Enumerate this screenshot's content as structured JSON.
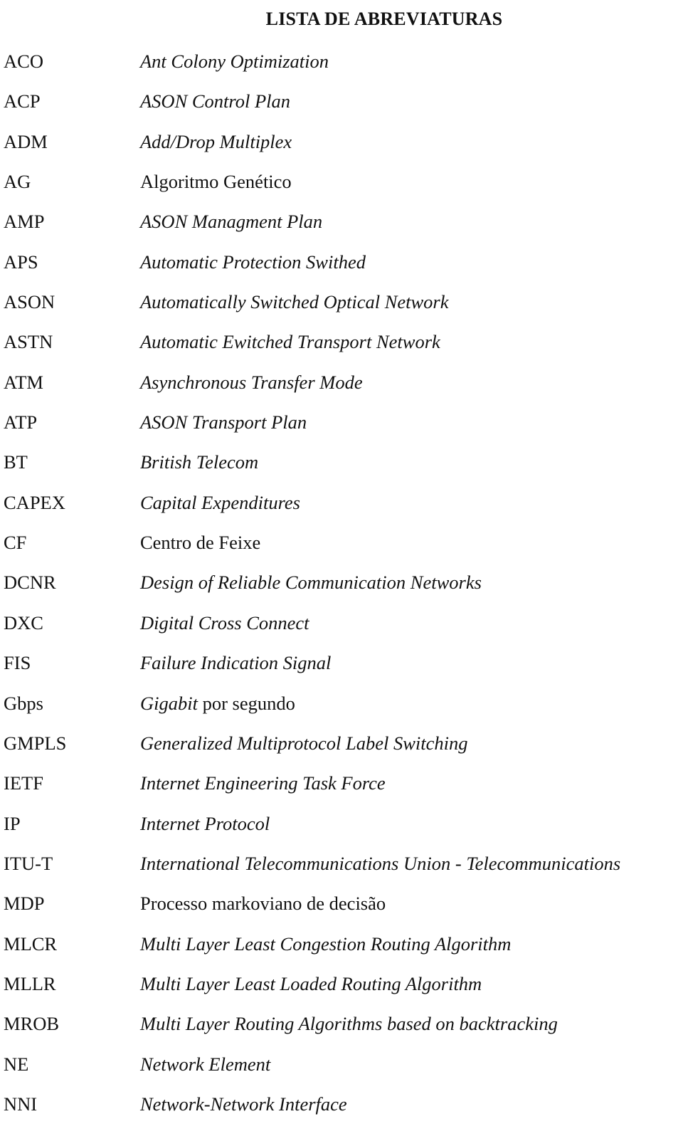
{
  "page": {
    "title": "LISTA DE ABREVIATURAS"
  },
  "abbreviations": [
    {
      "abbr": "ACO",
      "parts": [
        {
          "text": "Ant Colony Optimization",
          "italic": true
        }
      ]
    },
    {
      "abbr": "ACP",
      "parts": [
        {
          "text": "ASON Control Plan",
          "italic": true
        }
      ]
    },
    {
      "abbr": "ADM",
      "parts": [
        {
          "text": "Add/Drop Multiplex",
          "italic": true
        }
      ]
    },
    {
      "abbr": "AG",
      "parts": [
        {
          "text": "Algoritmo Genético",
          "italic": false
        }
      ]
    },
    {
      "abbr": "AMP",
      "parts": [
        {
          "text": "ASON Managment Plan",
          "italic": true
        }
      ]
    },
    {
      "abbr": "APS",
      "parts": [
        {
          "text": "Automatic Protection Swithed",
          "italic": true
        }
      ]
    },
    {
      "abbr": "ASON",
      "parts": [
        {
          "text": "Automatically Switched Optical Network",
          "italic": true
        }
      ]
    },
    {
      "abbr": "ASTN",
      "parts": [
        {
          "text": "Automatic Ewitched Transport Network",
          "italic": true
        }
      ]
    },
    {
      "abbr": "ATM",
      "parts": [
        {
          "text": "Asynchronous Transfer Mode",
          "italic": true
        }
      ]
    },
    {
      "abbr": "ATP",
      "parts": [
        {
          "text": "ASON Transport Plan",
          "italic": true
        }
      ]
    },
    {
      "abbr": "BT",
      "parts": [
        {
          "text": "British Telecom",
          "italic": true
        }
      ]
    },
    {
      "abbr": "CAPEX",
      "parts": [
        {
          "text": "Capital Expenditures",
          "italic": true
        }
      ]
    },
    {
      "abbr": "CF",
      "parts": [
        {
          "text": "Centro de Feixe",
          "italic": false
        }
      ]
    },
    {
      "abbr": "DCNR",
      "parts": [
        {
          "text": "Design of Reliable Communication Networks",
          "italic": true
        }
      ]
    },
    {
      "abbr": "DXC",
      "parts": [
        {
          "text": "Digital Cross Connect",
          "italic": true
        }
      ]
    },
    {
      "abbr": "FIS",
      "parts": [
        {
          "text": "Failure Indication Signal",
          "italic": true
        }
      ]
    },
    {
      "abbr": "Gbps",
      "parts": [
        {
          "text": "Gigabit",
          "italic": true
        },
        {
          "text": " por segundo",
          "italic": false
        }
      ]
    },
    {
      "abbr": "GMPLS",
      "parts": [
        {
          "text": "Generalized Multiprotocol Label Switching",
          "italic": true
        }
      ]
    },
    {
      "abbr": "IETF",
      "parts": [
        {
          "text": "Internet Engineering Task Force",
          "italic": true
        }
      ]
    },
    {
      "abbr": "IP",
      "parts": [
        {
          "text": "Internet Protocol",
          "italic": true
        }
      ]
    },
    {
      "abbr": "ITU-T",
      "parts": [
        {
          "text": "International Telecommunications Union - Telecommunications",
          "italic": true
        }
      ]
    },
    {
      "abbr": "MDP",
      "parts": [
        {
          "text": "Processo markoviano de decisão",
          "italic": false
        }
      ]
    },
    {
      "abbr": "MLCR",
      "parts": [
        {
          "text": "Multi Layer Least Congestion Routing Algorithm",
          "italic": true
        }
      ]
    },
    {
      "abbr": "MLLR",
      "parts": [
        {
          "text": "Multi Layer Least Loaded Routing Algorithm",
          "italic": true
        }
      ]
    },
    {
      "abbr": "MROB",
      "parts": [
        {
          "text": "Multi Layer Routing Algorithms based on backtracking",
          "italic": true
        }
      ]
    },
    {
      "abbr": "NE",
      "parts": [
        {
          "text": "Network Element",
          "italic": true
        }
      ]
    },
    {
      "abbr": "NNI",
      "parts": [
        {
          "text": "Network-Network Interface",
          "italic": true
        }
      ]
    }
  ]
}
